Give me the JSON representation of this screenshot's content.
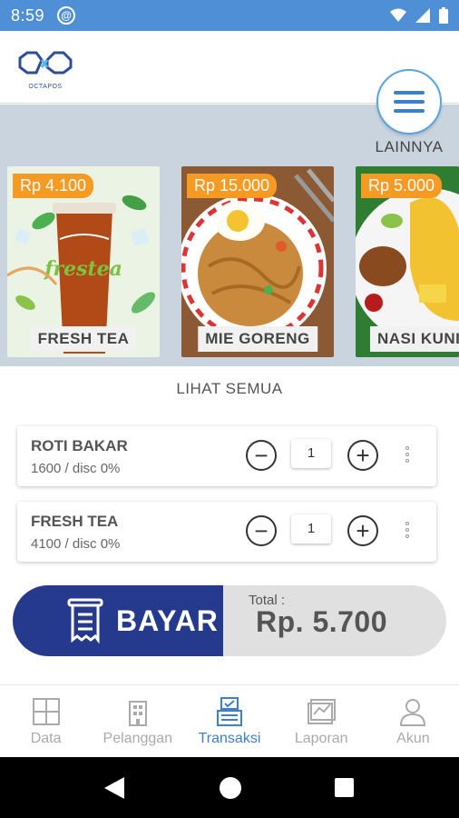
{
  "status_bar": {
    "time": "8:59"
  },
  "header": {
    "logo_text": "OCTAPOS"
  },
  "menu": {
    "label": "LAINNYA"
  },
  "products": [
    {
      "price": "Rp 4.100",
      "name": "FRESH TEA"
    },
    {
      "price": "Rp 15.000",
      "name": "MIE GORENG"
    },
    {
      "price": "Rp 5.000",
      "name": "NASI KUNING"
    }
  ],
  "see_all": "LIHAT SEMUA",
  "cart": {
    "items": [
      {
        "name": "ROTI BAKAR",
        "meta": "1600   /   disc 0%",
        "qty": "1"
      },
      {
        "name": "FRESH TEA",
        "meta": "4100   /   disc 0%",
        "qty": "1"
      }
    ]
  },
  "payment": {
    "button_label": "BAYAR",
    "total_label": "Total :",
    "total_value": "Rp. 5.700"
  },
  "bottom_nav": [
    {
      "label": "Data",
      "icon": "grid-icon"
    },
    {
      "label": "Pelanggan",
      "icon": "building-icon"
    },
    {
      "label": "Transaksi",
      "icon": "cash-register-icon"
    },
    {
      "label": "Laporan",
      "icon": "chart-report-icon"
    },
    {
      "label": "Akun",
      "icon": "user-icon"
    }
  ],
  "colors": {
    "status_bar": "#4f8fd6",
    "accent": "#3f7fc8",
    "pay_button": "#263a8d",
    "price_tag": "#f59b23"
  }
}
